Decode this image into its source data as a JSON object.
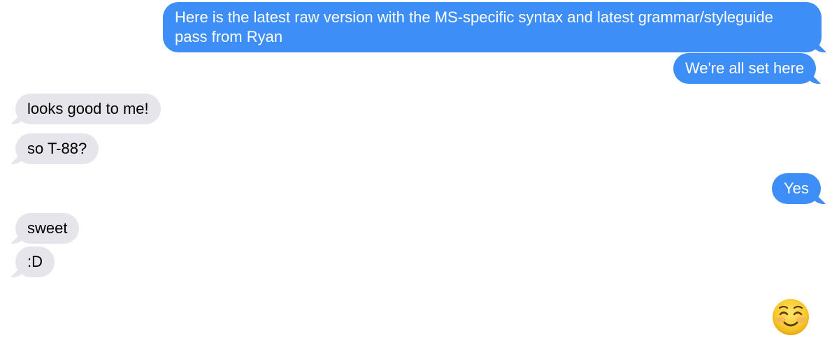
{
  "conversation": {
    "messages": [
      {
        "direction": "sent",
        "text": "Here is the latest raw version with the MS-specific syntax and latest grammar/styleguide pass from Ryan"
      },
      {
        "direction": "sent",
        "text": "We're all set here"
      },
      {
        "direction": "received",
        "text": "looks good to me!"
      },
      {
        "direction": "received",
        "text": "so T-88?"
      },
      {
        "direction": "sent",
        "text": "Yes"
      },
      {
        "direction": "received",
        "text": "sweet"
      },
      {
        "direction": "received",
        "text": ":D"
      }
    ],
    "emoji_message": {
      "direction": "sent",
      "icon": "smiling-face-icon"
    }
  },
  "colors": {
    "sent_bubble": "#3e8ef7",
    "received_bubble": "#e6e5eb",
    "sent_text": "#ffffff",
    "received_text": "#000000"
  }
}
